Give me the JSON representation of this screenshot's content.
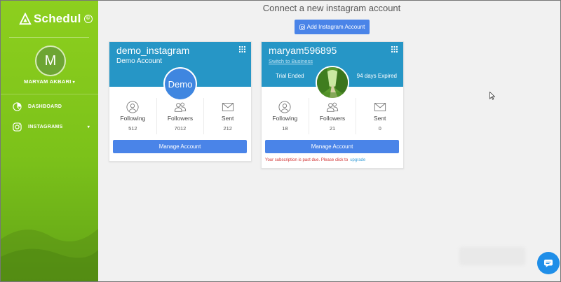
{
  "app": {
    "name": "Schedul"
  },
  "user": {
    "initial": "M",
    "name": "MARYAM AKBARI"
  },
  "sidebar": {
    "items": [
      {
        "label": "DASHBOARD",
        "icon": "dashboard-icon"
      },
      {
        "label": "INSTAGRAMS",
        "icon": "instagram-icon"
      }
    ]
  },
  "header": {
    "title": "Connect a new instagram account",
    "add_button": "Add Instagram Account"
  },
  "accounts": [
    {
      "handle": "demo_instagram",
      "subtitle": "Demo Account",
      "avatar_text": "Demo",
      "stats": [
        {
          "label": "Following",
          "value": "512",
          "icon": "person-icon"
        },
        {
          "label": "Followers",
          "value": "7012",
          "icon": "people-icon"
        },
        {
          "label": "Sent",
          "value": "212",
          "icon": "envelope-icon"
        }
      ],
      "manage_label": "Manage Account"
    },
    {
      "handle": "maryam596895",
      "switch_link": "Switch to Business",
      "trial_status": "Trial Ended",
      "expired_status": "94 days Expired",
      "stats": [
        {
          "label": "Following",
          "value": "18",
          "icon": "person-icon"
        },
        {
          "label": "Followers",
          "value": "21",
          "icon": "people-icon"
        },
        {
          "label": "Sent",
          "value": "0",
          "icon": "envelope-icon"
        }
      ],
      "manage_label": "Manage Account",
      "due_notice": "Your subscription is past due. Please click to",
      "upgrade_link": "upgrade"
    }
  ],
  "colors": {
    "sidebar_green": "#7cc21a",
    "card_header_blue": "#2696c6",
    "button_blue": "#4a84e8",
    "alert_red": "#d03030"
  }
}
